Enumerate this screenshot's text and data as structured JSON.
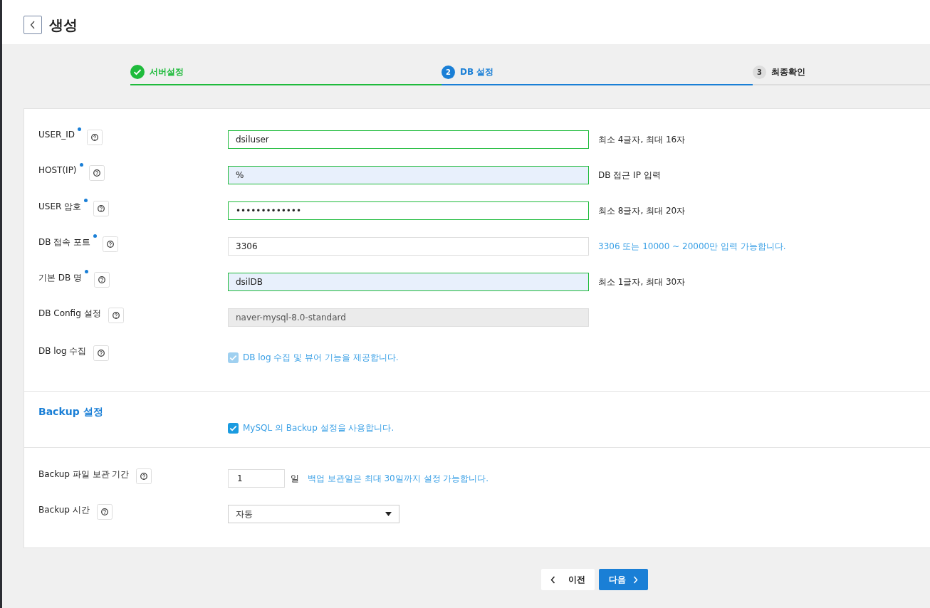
{
  "page": {
    "title": "생성"
  },
  "steps": [
    {
      "label": "서버설정",
      "done": true,
      "selected": false
    },
    {
      "label": "DB 설정",
      "number": "2",
      "done": false,
      "selected": true
    },
    {
      "label": "최종확인",
      "number": "3",
      "done": false,
      "selected": false
    }
  ],
  "fields": [
    {
      "kind": "text",
      "label": "USER_ID",
      "required": true,
      "value": "dsiluser",
      "validated": true,
      "autofilled": false,
      "hint": "최소 4글자, 최대 16자",
      "hint_info": false
    },
    {
      "kind": "text",
      "label": "HOST(IP)",
      "required": true,
      "value": "%",
      "validated": true,
      "autofilled": true,
      "hint": "DB 접근 IP 입력",
      "hint_info": false
    },
    {
      "kind": "text",
      "label": "USER 암호",
      "required": true,
      "value": "•••••••••••••",
      "validated": true,
      "autofilled": false,
      "hint": "최소 8글자, 최대 20자",
      "hint_info": false
    },
    {
      "kind": "text",
      "label": "DB 접속 포트",
      "required": true,
      "value": "3306",
      "validated": false,
      "autofilled": false,
      "hint": "3306 또는 10000 ~ 20000만 입력 가능합니다.",
      "hint_info": true
    },
    {
      "kind": "text",
      "label": "기본 DB 명",
      "required": true,
      "value": "dsilDB",
      "validated": true,
      "autofilled": true,
      "hint": "최소 1글자, 최대 30자",
      "hint_info": false
    },
    {
      "kind": "text",
      "label": "DB Config 설정",
      "required": false,
      "value": "naver-mysql-8.0-standard",
      "disabled": true
    },
    {
      "kind": "checkbox",
      "label": "DB log 수집",
      "required": false,
      "option": "DB log 수집 및 뷰어 기능을 제공합니다.",
      "checked": true,
      "disabled": true
    }
  ],
  "backup": {
    "title": "Backup 설정",
    "option": "MySQL 의 Backup 설정을 사용합니다.",
    "checked": true,
    "retention": {
      "label": "Backup 파일 보관 기간",
      "value": "1",
      "unit": "일",
      "hint": "백업 보관일은 최대 30일까지 설정 가능합니다."
    },
    "time": {
      "label": "Backup 시간",
      "value": "자동"
    }
  },
  "buttons": [
    {
      "label": "이전",
      "kind": "prev"
    },
    {
      "label": "다음",
      "kind": "next"
    }
  ]
}
